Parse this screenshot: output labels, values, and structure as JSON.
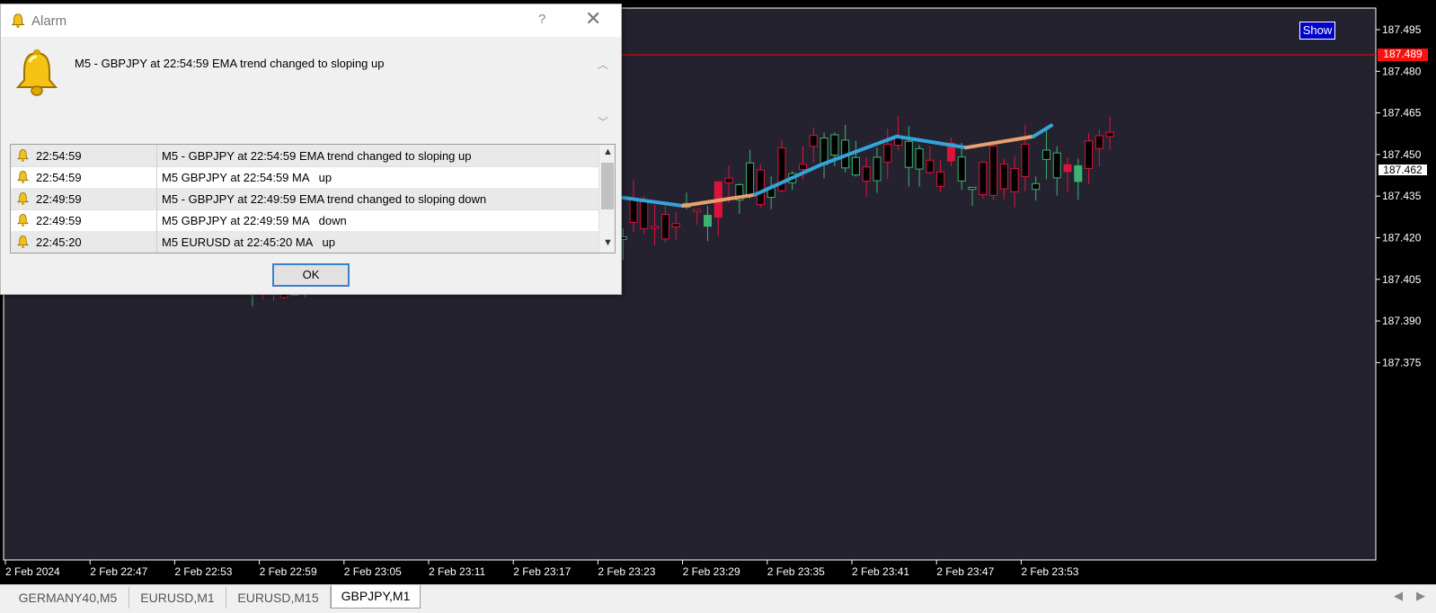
{
  "chart": {
    "show_label": "Show",
    "price_labels": [
      "187.495",
      "187.480",
      "187.465",
      "187.450",
      "187.435",
      "187.420",
      "187.405",
      "187.390",
      "187.375"
    ],
    "time_labels": [
      "2 Feb 2024",
      "2 Feb 22:47",
      "2 Feb 22:53",
      "2 Feb 22:59",
      "2 Feb 23:05",
      "2 Feb 23:11",
      "2 Feb 23:17",
      "2 Feb 23:23",
      "2 Feb 23:29",
      "2 Feb 23:35",
      "2 Feb 23:41",
      "2 Feb 23:47",
      "2 Feb 23:53"
    ],
    "alert_price": "187.489",
    "current_price": "187.462",
    "colors": {
      "background": "#252230",
      "bull": "#3cb371",
      "bear": "#dc143c",
      "ema_up": "#32a4d8",
      "ema_down": "#e8a070",
      "alert_line": "#ff0000"
    }
  },
  "alarm": {
    "title": "Alarm",
    "help": "?",
    "close": "✕",
    "message": "M5 - GBPJPY at 22:54:59 EMA trend changed to sloping up",
    "rows": [
      {
        "time": "22:54:59",
        "msg": "M5 - GBPJPY at 22:54:59 EMA trend changed to sloping up"
      },
      {
        "time": "22:54:59",
        "msg": "M5 GBPJPY at 22:54:59 MA   up"
      },
      {
        "time": "22:49:59",
        "msg": "M5 - GBPJPY at 22:49:59 EMA trend changed to sloping down"
      },
      {
        "time": "22:49:59",
        "msg": "M5 GBPJPY at 22:49:59 MA   down"
      },
      {
        "time": "22:45:20",
        "msg": "M5 EURUSD at 22:45:20 MA   up"
      }
    ],
    "ok_label": "OK"
  },
  "tabs": [
    {
      "label": "GERMANY40,M5",
      "active": false
    },
    {
      "label": "EURUSD,M1",
      "active": false
    },
    {
      "label": "EURUSD,M15",
      "active": false
    },
    {
      "label": "GBPJPY,M1",
      "active": true
    }
  ],
  "tab_nav": {
    "prev": "◀",
    "next": "▶"
  }
}
